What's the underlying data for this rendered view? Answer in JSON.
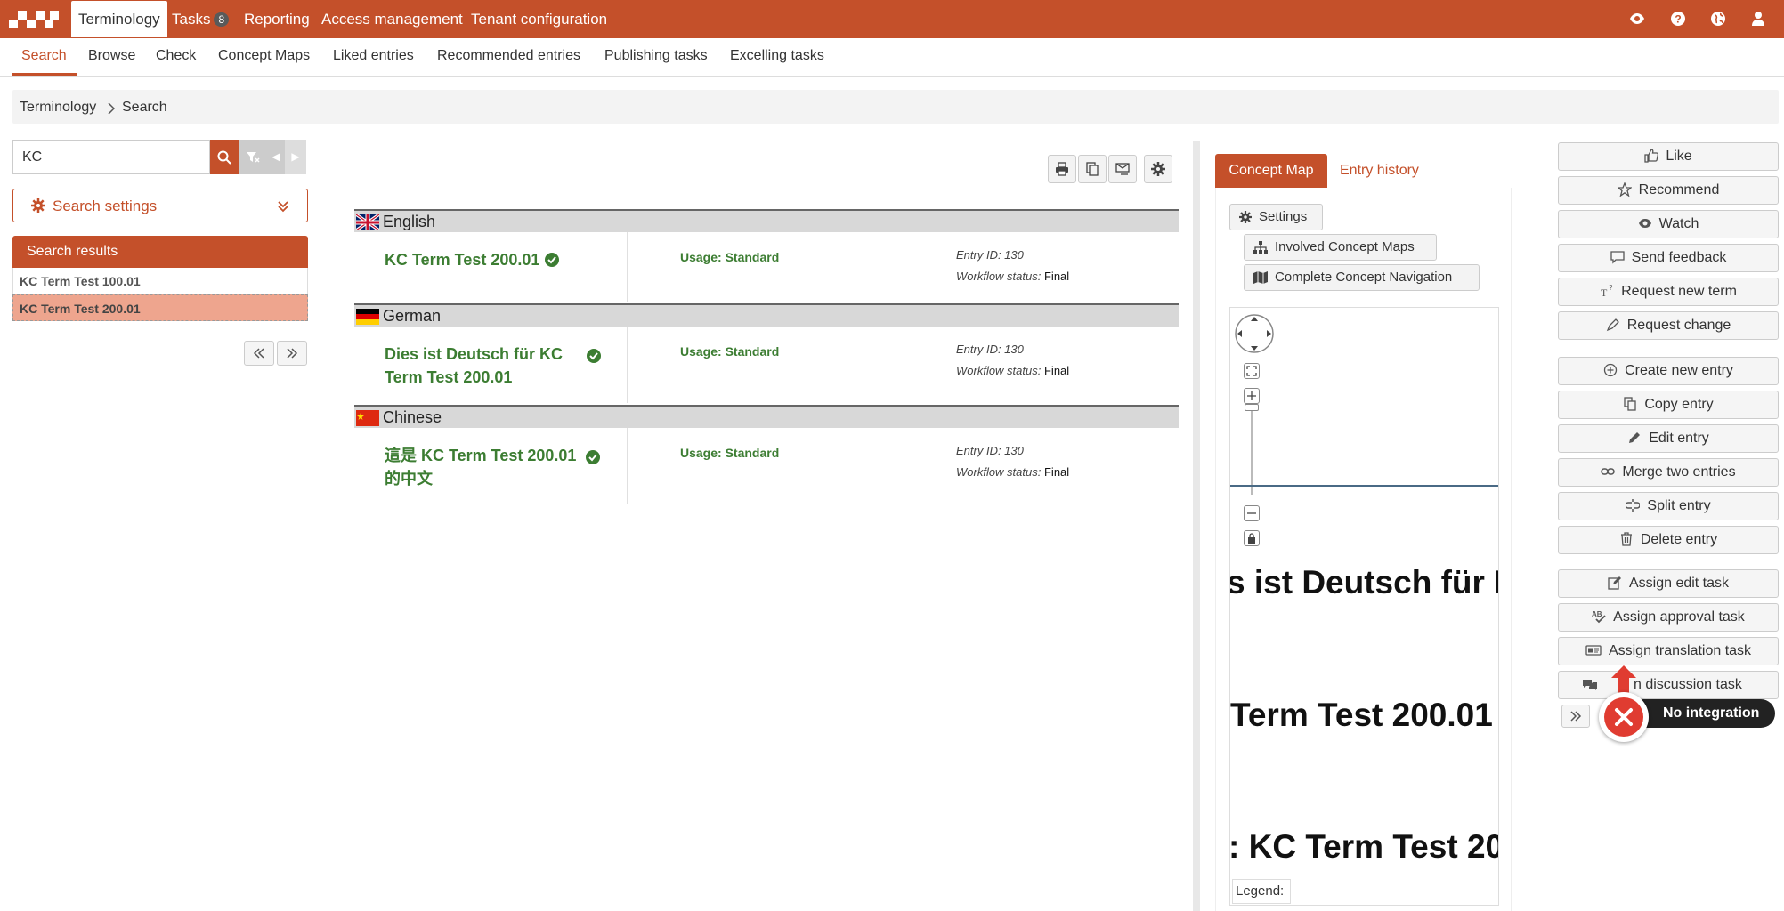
{
  "topbar": {
    "nav": [
      {
        "label": "Terminology"
      },
      {
        "label": "Tasks",
        "badge": "8"
      },
      {
        "label": "Reporting"
      },
      {
        "label": "Access management"
      },
      {
        "label": "Tenant configuration"
      }
    ],
    "icons": [
      "eye-icon",
      "help-icon",
      "globe-icon",
      "user-icon"
    ],
    "brand_color": "#c4502a"
  },
  "subnav": [
    {
      "label": "Search"
    },
    {
      "label": "Browse"
    },
    {
      "label": "Check"
    },
    {
      "label": "Concept Maps"
    },
    {
      "label": "Liked entries"
    },
    {
      "label": "Recommended entries"
    },
    {
      "label": "Publishing tasks"
    },
    {
      "label": "Excelling tasks"
    }
  ],
  "breadcrumb": [
    "Terminology",
    "Search"
  ],
  "search": {
    "value": "KC",
    "settings_label": "Search settings",
    "results_title": "Search results",
    "results": [
      "KC Term Test 100.01",
      "KC Term Test 200.01"
    ]
  },
  "entries": [
    {
      "language": "English",
      "term_lines": [
        "KC Term Test 200.01"
      ],
      "usage": "Usage: Standard",
      "entry_id": "Entry ID: 130",
      "workflow_label": "Workflow status:",
      "workflow_value": "Final"
    },
    {
      "language": "German",
      "term_lines": [
        "Dies ist Deutsch für KC",
        "Term Test 200.01"
      ],
      "usage": "Usage: Standard",
      "entry_id": "Entry ID: 130",
      "workflow_label": "Workflow status:",
      "workflow_value": "Final"
    },
    {
      "language": "Chinese",
      "term_lines": [
        "這是 KC Term Test 200.01",
        "的中文"
      ],
      "usage": "Usage: Standard",
      "entry_id": "Entry ID: 130",
      "workflow_label": "Workflow status:",
      "workflow_value": "Final"
    }
  ],
  "concept_panel": {
    "tabs": [
      "Concept Map",
      "Entry history"
    ],
    "settings_label": "Settings",
    "involved_label": "Involved Concept Maps",
    "navigation_label": "Complete Concept Navigation",
    "map_texts": [
      "s ist Deutsch für K",
      "Term Test 200.01",
      ": KC Term Test 200"
    ],
    "legend_label": "Legend:"
  },
  "actions": [
    {
      "label": "Like",
      "icon": "thumbs-up-icon"
    },
    {
      "label": "Recommend",
      "icon": "star-icon"
    },
    {
      "label": "Watch",
      "icon": "eye-icon"
    },
    {
      "label": "Send feedback",
      "icon": "comment-icon"
    },
    {
      "label": "Request new term",
      "icon": "new-term-icon"
    },
    {
      "label": "Request change",
      "icon": "pen-icon"
    },
    {
      "label": "Create new entry",
      "icon": "plus-circle-icon"
    },
    {
      "label": "Copy entry",
      "icon": "copy-icon"
    },
    {
      "label": "Edit entry",
      "icon": "pencil-icon"
    },
    {
      "label": "Merge two entries",
      "icon": "link-icon"
    },
    {
      "label": "Split entry",
      "icon": "split-icon"
    },
    {
      "label": "Delete entry",
      "icon": "trash-icon"
    },
    {
      "label": "Assign edit task",
      "icon": "edit-square-icon"
    },
    {
      "label": "Assign approval task",
      "icon": "spellcheck-icon"
    },
    {
      "label": "Assign translation task",
      "icon": "id-card-icon"
    },
    {
      "label": "Assign discussion task",
      "visible_label": "n discussion task",
      "icon": "comments-icon"
    }
  ],
  "notification": {
    "label": "No integration",
    "icon": "error-x-icon"
  }
}
